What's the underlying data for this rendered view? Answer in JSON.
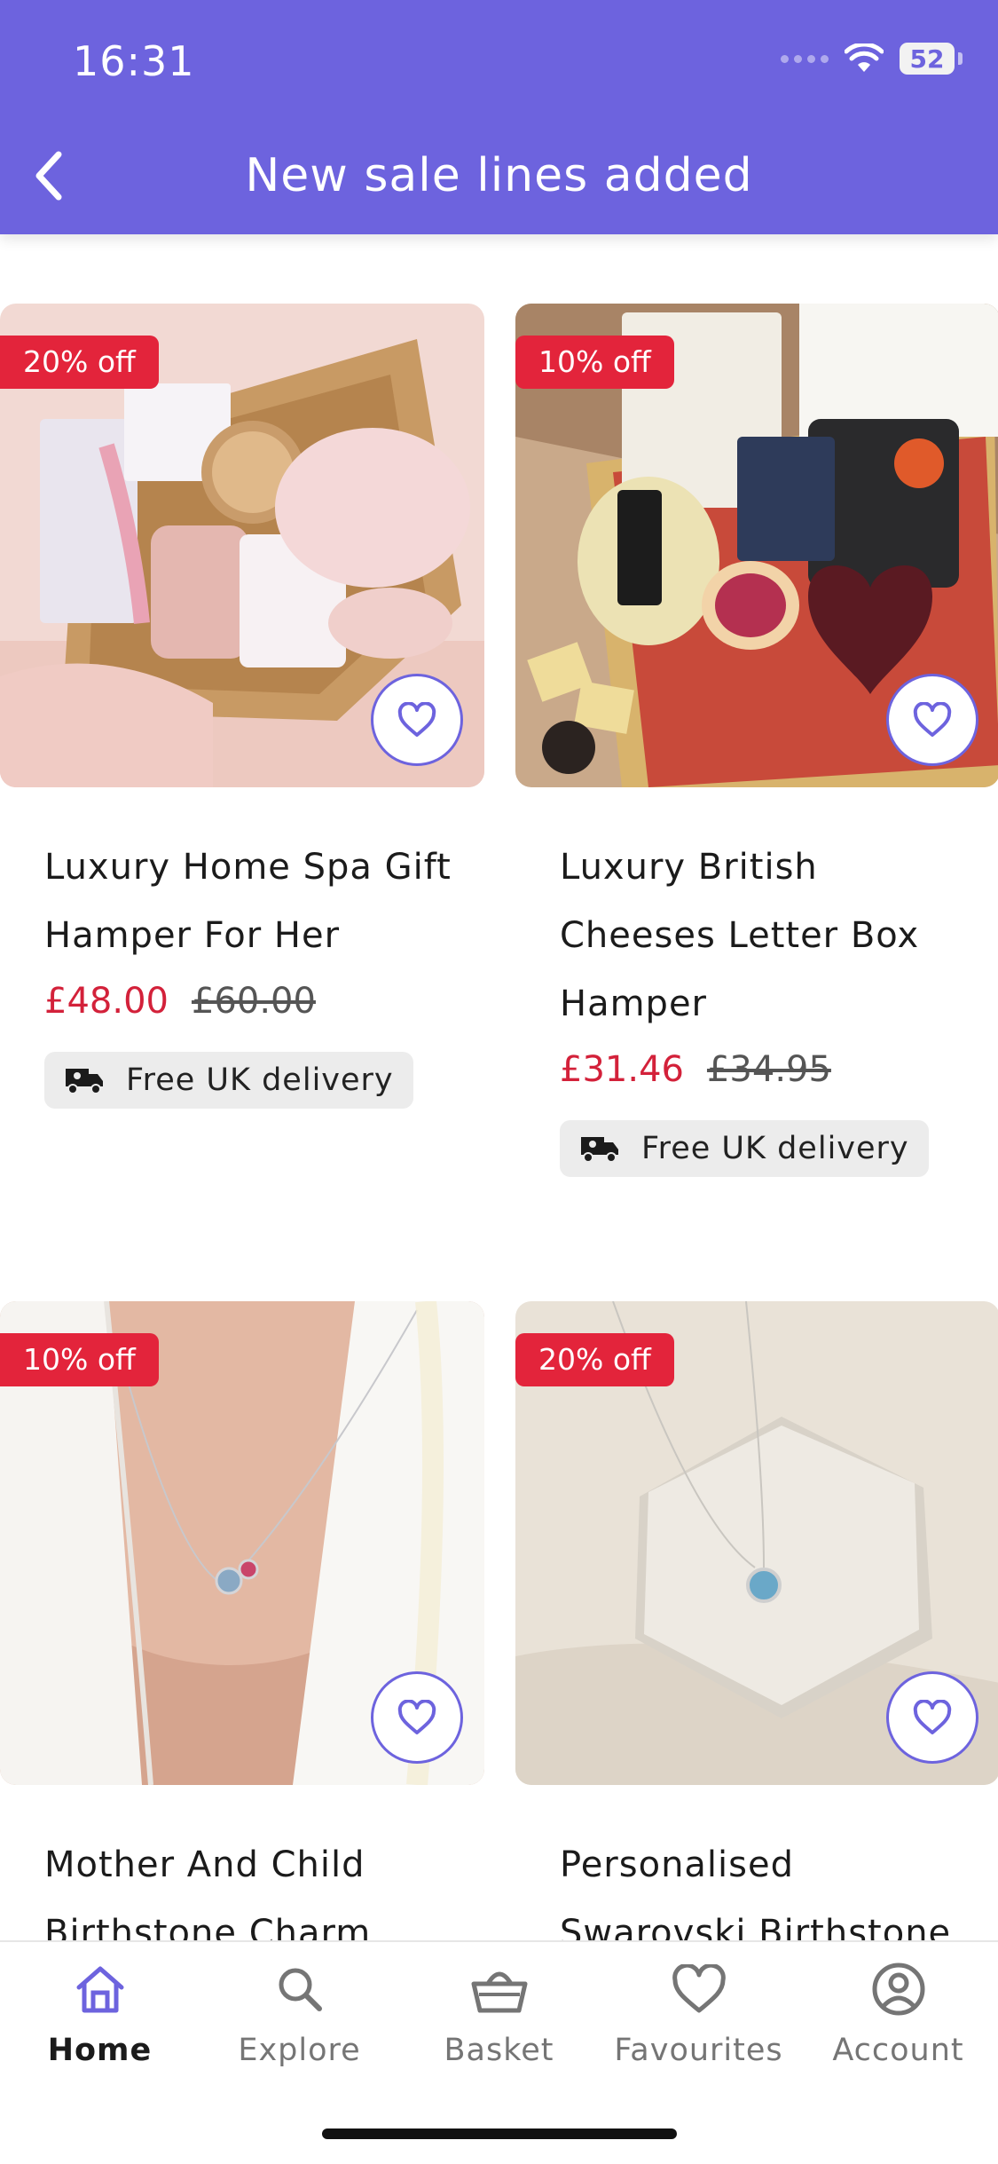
{
  "status_bar": {
    "time": "16:31",
    "battery": "52"
  },
  "header": {
    "title": "New sale lines added"
  },
  "colors": {
    "brand": "#6d63de",
    "sale_red": "#e3243b",
    "price_red": "#d3213a"
  },
  "products": [
    {
      "badge": "20% off",
      "name": "Luxury Home Spa Gift Hamper For Her",
      "price": "£48.00",
      "was": "£60.00",
      "delivery": "Free UK delivery"
    },
    {
      "badge": "10% off",
      "name": "Luxury British Cheeses Letter Box Hamper",
      "price": "£31.46",
      "was": "£34.95",
      "delivery": "Free UK delivery"
    },
    {
      "badge": "10% off",
      "name": "Mother And Child Birthstone Charm"
    },
    {
      "badge": "20% off",
      "name": "Personalised Swarovski Birthstone"
    }
  ],
  "tabbar": {
    "items": [
      {
        "label": "Home",
        "icon": "home-icon",
        "active": true
      },
      {
        "label": "Explore",
        "icon": "search-icon"
      },
      {
        "label": "Basket",
        "icon": "basket-icon"
      },
      {
        "label": "Favourites",
        "icon": "heart-icon"
      },
      {
        "label": "Account",
        "icon": "account-icon"
      }
    ]
  }
}
